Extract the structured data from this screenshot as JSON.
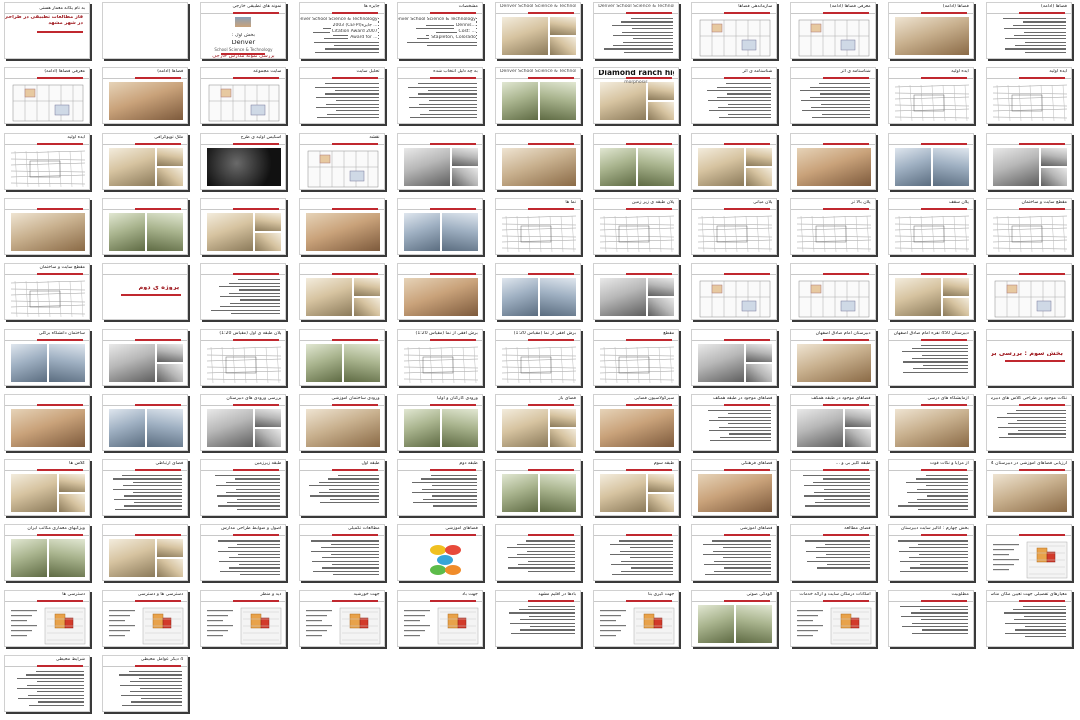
{
  "slides": [
    {
      "title": "به نام یگانه معمار هستی",
      "title_style": "plain",
      "sub": [
        "فاز مطالعات تطبیقی در طراحی هنرستان",
        "در شهر مشهد"
      ],
      "kind": "cover"
    },
    {
      "title": "",
      "kind": "blank"
    },
    {
      "title": "نمونه های تطبیقی خارجی",
      "kind": "cover2",
      "sub": [
        "بخش اول :",
        "Denver",
        "School Science & Technology",
        "بررسی نمونه مدارس خارجی"
      ]
    },
    {
      "title": "جایزه ها",
      "kind": "text",
      "sub": [
        "Denver School Science & Technology",
        "2003 (CEFPI)جایزه ...",
        "Citation Award 2007",
        "Award for ..."
      ]
    },
    {
      "title": "مشخصات",
      "kind": "text",
      "sub": [
        "Denver School Science & Technology",
        "Dennis...",
        "Cost: ...",
        "Stapleton, Colorado"
      ]
    },
    {
      "title": "Denver School Science & Technology",
      "title_style": "ltr",
      "kind": "photo"
    },
    {
      "title": "Denver School Science & Technology",
      "title_style": "ltr",
      "kind": "text"
    },
    {
      "title": "سازماندهی فضاها",
      "kind": "plan"
    },
    {
      "title": "معرفی فضاها (ادامه)",
      "kind": "plan"
    },
    {
      "title": "فضاها (ادامه)",
      "kind": "photo"
    },
    {
      "title": "فضاها (ادامه)",
      "kind": "text"
    },
    {
      "title": "معرفی فضاها (ادامه)",
      "kind": "plan"
    },
    {
      "title": "فضاها (ادامه)",
      "kind": "photo"
    },
    {
      "title": "سایت مجموعه",
      "kind": "plan"
    },
    {
      "title": "تحلیل سایت",
      "kind": "text"
    },
    {
      "title": "به چه دلیل انتخاب شده",
      "kind": "text"
    },
    {
      "title": "Denver School Science & Technology",
      "title_style": "ltr",
      "kind": "photo"
    },
    {
      "title": "Diamond ranch high school",
      "title_style": "big-ltr",
      "kind": "photo",
      "sub": [
        "morphosis"
      ]
    },
    {
      "title": "شناسنامه ی اثر",
      "kind": "text"
    },
    {
      "title": "شناسنامه ی اثر",
      "kind": "text"
    },
    {
      "title": "ایده اولیه",
      "kind": "drawing"
    },
    {
      "title": "ایده اولیه",
      "kind": "drawing"
    },
    {
      "title": "ایده اولیه",
      "kind": "drawing"
    },
    {
      "title": "ملک توپوگرافی",
      "kind": "photo"
    },
    {
      "title": "اسکیس اولیه ی طرح",
      "kind": "dark"
    },
    {
      "title": "نقشه",
      "kind": "plan"
    },
    {
      "title": "",
      "kind": "photo"
    },
    {
      "title": "",
      "kind": "photo"
    },
    {
      "title": "",
      "kind": "photo"
    },
    {
      "title": "",
      "kind": "photo"
    },
    {
      "title": "",
      "kind": "photo"
    },
    {
      "title": "",
      "kind": "photo"
    },
    {
      "title": "",
      "kind": "photo"
    },
    {
      "title": "",
      "kind": "photo"
    },
    {
      "title": "",
      "kind": "photo"
    },
    {
      "title": "",
      "kind": "photo"
    },
    {
      "title": "",
      "kind": "photo"
    },
    {
      "title": "",
      "kind": "photo"
    },
    {
      "title": "نما ها",
      "kind": "drawing"
    },
    {
      "title": "پلان طبقه ی زیر زمین",
      "kind": "drawing"
    },
    {
      "title": "پلان میانی",
      "kind": "drawing"
    },
    {
      "title": "پلان بالا تر",
      "kind": "drawing"
    },
    {
      "title": "پلان سقف",
      "kind": "drawing"
    },
    {
      "title": "مقطع سایت و ساختمان",
      "kind": "drawing"
    },
    {
      "title": "مقطع سایت و ساختمان",
      "kind": "drawing"
    },
    {
      "title": "پروژه ی دوم",
      "title_style": "big",
      "kind": "title"
    },
    {
      "title": "",
      "kind": "text"
    },
    {
      "title": "",
      "kind": "photo"
    },
    {
      "title": "",
      "kind": "photo"
    },
    {
      "title": "",
      "kind": "photo"
    },
    {
      "title": "",
      "kind": "photo"
    },
    {
      "title": "",
      "kind": "plan"
    },
    {
      "title": "",
      "kind": "plan"
    },
    {
      "title": "",
      "kind": "photo"
    },
    {
      "title": "",
      "kind": "plan"
    },
    {
      "title": "ساختمان دانشگاه برکلی",
      "kind": "photo"
    },
    {
      "title": "",
      "kind": "photo"
    },
    {
      "title": "پلان طبقه ی اول (مقیاس 1:20)",
      "kind": "drawing"
    },
    {
      "title": "",
      "kind": "photo"
    },
    {
      "title": "برش افقی از نما (مقیاس 1:20)",
      "kind": "drawing"
    },
    {
      "title": "برش افقی از نما (مقیاس 1:20)",
      "kind": "drawing"
    },
    {
      "title": "مقطع",
      "kind": "drawing"
    },
    {
      "title": "",
      "kind": "photo"
    },
    {
      "title": "دبیرستان امام صادق اصفهان",
      "kind": "photo"
    },
    {
      "title": "دبیرستان 450 نفره امام صادق اصفهان",
      "kind": "text"
    },
    {
      "title": "بخش سوم : بررسی برخی از مدارس داخلی ایران",
      "title_style": "big",
      "kind": "title"
    },
    {
      "title": "",
      "kind": "photo"
    },
    {
      "title": "",
      "kind": "photo"
    },
    {
      "title": "بررسی ورودی های دبیرستان",
      "kind": "photo"
    },
    {
      "title": "ورودی ساختمان آموزشی",
      "kind": "photo"
    },
    {
      "title": "ورودی کارکنان و اولیا",
      "kind": "photo"
    },
    {
      "title": "فضای باز",
      "kind": "photo"
    },
    {
      "title": "سیرکولاسیون فضایی",
      "kind": "photo"
    },
    {
      "title": "فضاهای موجود در طبقه همکف",
      "kind": "text"
    },
    {
      "title": "فضاهای موجود در طبقه همکف",
      "kind": "photo"
    },
    {
      "title": "آزمایشگاه های درسی",
      "kind": "photo"
    },
    {
      "title": "نکات موجود در طراحی کلاس های دبیرستان",
      "kind": "text"
    },
    {
      "title": "کلاس ها",
      "kind": "photo"
    },
    {
      "title": "فضای ارتباطی",
      "kind": "text"
    },
    {
      "title": "طبقه زیرزمین",
      "kind": "text"
    },
    {
      "title": "طبقه اول",
      "kind": "text"
    },
    {
      "title": "طبقه دوم",
      "kind": "text"
    },
    {
      "title": "",
      "kind": "photo"
    },
    {
      "title": "طبقه سوم",
      "kind": "photo"
    },
    {
      "title": "فضاهای فرهنگی",
      "kind": "photo"
    },
    {
      "title": "طبقه گلیز بی و ...",
      "kind": "text"
    },
    {
      "title": "از مزایا و نکات قوت",
      "kind": "text"
    },
    {
      "title": "ارزیابی فضاهای آموزشی در دبیرستان 4 طبقه",
      "kind": "photo"
    },
    {
      "title": "ویژگیهای معماری مکاتب ایران",
      "kind": "photo"
    },
    {
      "title": "",
      "kind": "photo"
    },
    {
      "title": "اصول و ضوابط طراحی مدارس",
      "kind": "text"
    },
    {
      "title": "مطالعات تکمیلی",
      "kind": "text"
    },
    {
      "title": "فضاهای آموزشی",
      "kind": "diagram"
    },
    {
      "title": "",
      "kind": "text"
    },
    {
      "title": "",
      "kind": "text"
    },
    {
      "title": "فضاهای آموزشی",
      "kind": "text"
    },
    {
      "title": "فضای مطالعه",
      "kind": "text"
    },
    {
      "title": "بخش چهارم : آنالیز سایت دبیرستان",
      "kind": "text"
    },
    {
      "title": "",
      "kind": "map"
    },
    {
      "title": "دسترسی ها",
      "kind": "map"
    },
    {
      "title": "دسترسی ها و دسترسی",
      "kind": "map"
    },
    {
      "title": "دید و منظر",
      "kind": "map"
    },
    {
      "title": "جهت خورشید",
      "kind": "map"
    },
    {
      "title": "جهت باد",
      "kind": "map"
    },
    {
      "title": "بادها در اقلیم مشهد",
      "kind": "text"
    },
    {
      "title": "جهت گیری بنا",
      "kind": "map"
    },
    {
      "title": "آلودگی صوتی",
      "kind": "photo"
    },
    {
      "title": "امکانات درمکان سایت و ارائه خدمات",
      "kind": "map"
    },
    {
      "title": "مطلوبیت",
      "kind": "text"
    },
    {
      "title": "معیارهای تفصیلی جهت تعیین مکان مناسب برای ساخت واحد آموزشی",
      "kind": "text"
    },
    {
      "title": "شرایط محیطی",
      "kind": "text"
    },
    {
      "title": "4 دیگر عوامل محیطی",
      "kind": "text"
    }
  ],
  "colors": {
    "accent": "#c0282f",
    "brand": "#a01c22",
    "page": "#ffffff",
    "frame": "#3a3a3a"
  }
}
